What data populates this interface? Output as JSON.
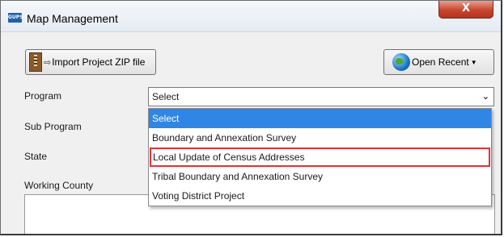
{
  "window": {
    "title": "Map Management",
    "app_icon_text": "GUPS",
    "close_symbol": "X"
  },
  "toolbar": {
    "import_label": "Import Project ZIP file",
    "recent_label": "Open Recent"
  },
  "form": {
    "program_label": "Program",
    "subprogram_label": "Sub Program",
    "state_label": "State",
    "county_label": "Working County",
    "program_value": "Select"
  },
  "dropdown": {
    "options": [
      "Select",
      "Boundary and Annexation Survey",
      "Local Update of Census Addresses",
      "Tribal Boundary and Annexation Survey",
      "Voting District Project"
    ],
    "selected_index": 0,
    "highlighted_index": 2,
    "highlight_color": "#e0323a",
    "selection_color": "#2f86e4"
  }
}
